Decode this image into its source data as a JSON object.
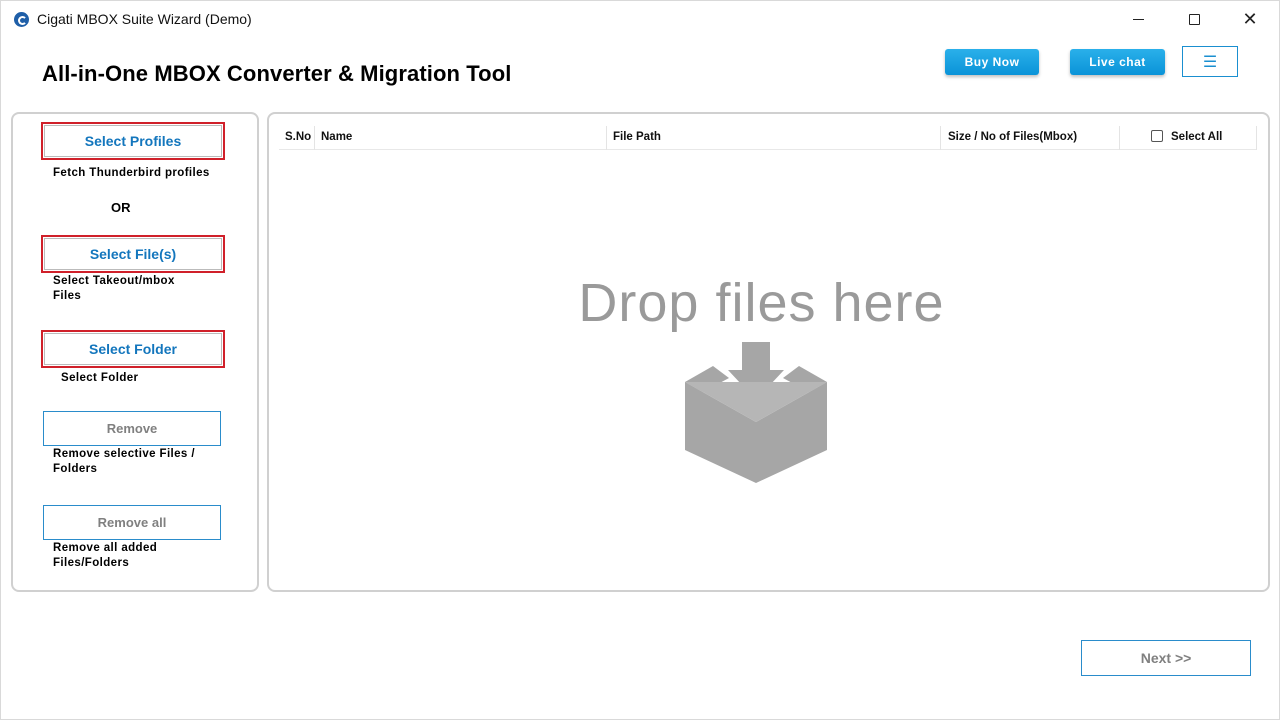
{
  "window": {
    "title": "Cigati MBOX Suite Wizard (Demo)",
    "controls": {
      "minimize": "",
      "maximize": "",
      "close": "✕"
    }
  },
  "header": {
    "title": "All-in-One MBOX Converter & Migration Tool",
    "buy_now": "Buy Now",
    "live_chat": "Live chat",
    "menu_icon": "☰"
  },
  "left_panel": {
    "select_profiles": {
      "label": "Select Profiles",
      "hint": "Fetch Thunderbird profiles"
    },
    "or_text": "OR",
    "select_files": {
      "label": "Select File(s)",
      "hint_line1": "Select Takeout/mbox",
      "hint_line2": "Files"
    },
    "select_folder": {
      "label": "Select Folder",
      "hint": "Select Folder"
    },
    "remove": {
      "label": "Remove",
      "hint_line1": "Remove selective Files /",
      "hint_line2": "Folders"
    },
    "remove_all": {
      "label": "Remove all",
      "hint_line1": "Remove all added",
      "hint_line2": "Files/Folders"
    }
  },
  "file_table": {
    "columns": {
      "sno": "S.No",
      "name": "Name",
      "file_path": "File Path",
      "size": "Size / No of Files(Mbox)",
      "select_all": "Select All"
    },
    "rows": []
  },
  "drop_zone": {
    "text": "Drop files here",
    "icon": "download-box-icon"
  },
  "footer": {
    "next": "Next >>"
  },
  "colors": {
    "accent_blue": "#0a93d8",
    "select_border_red": "#d0202a",
    "select_text_blue": "#1376bd",
    "disabled_text": "#808080"
  }
}
